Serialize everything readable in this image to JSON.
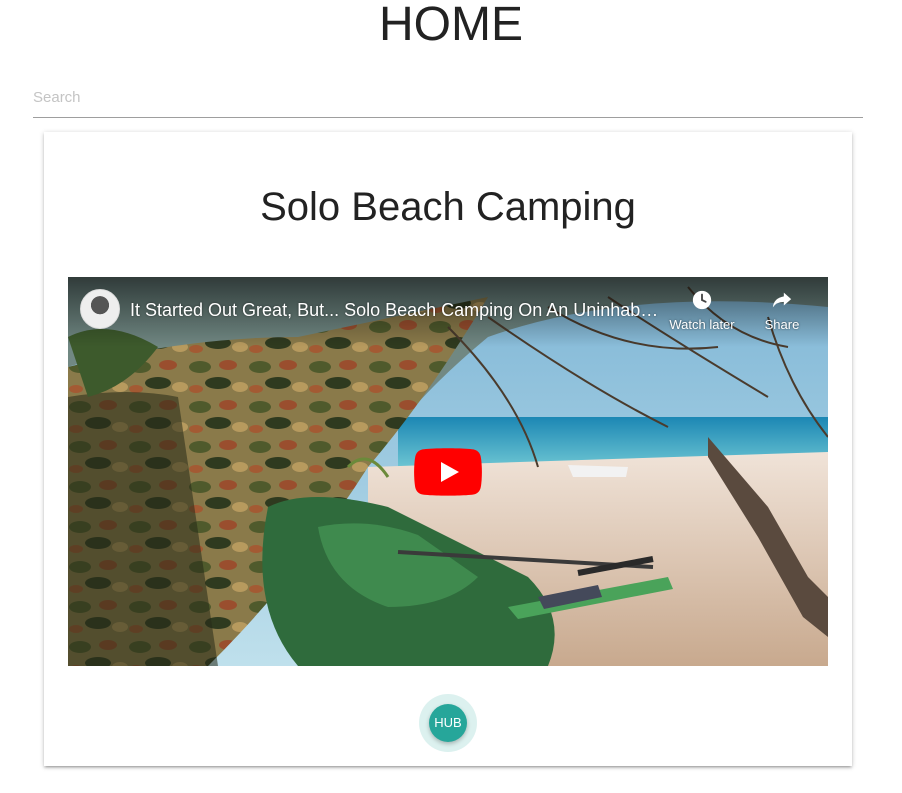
{
  "page": {
    "title": "HOME"
  },
  "search": {
    "placeholder": "Search",
    "value": ""
  },
  "card": {
    "title": "Solo Beach Camping",
    "video": {
      "title": "It Started Out Great, But... Solo Beach Camping On An Uninhabit...",
      "watch_later_label": "Watch later",
      "share_label": "Share",
      "play_icon": "play-icon",
      "play_color": "#ff0000"
    },
    "hub_button_label": "HUB"
  },
  "colors": {
    "accent": "#26a69a",
    "text": "#212121",
    "divider": "#9e9e9e"
  }
}
